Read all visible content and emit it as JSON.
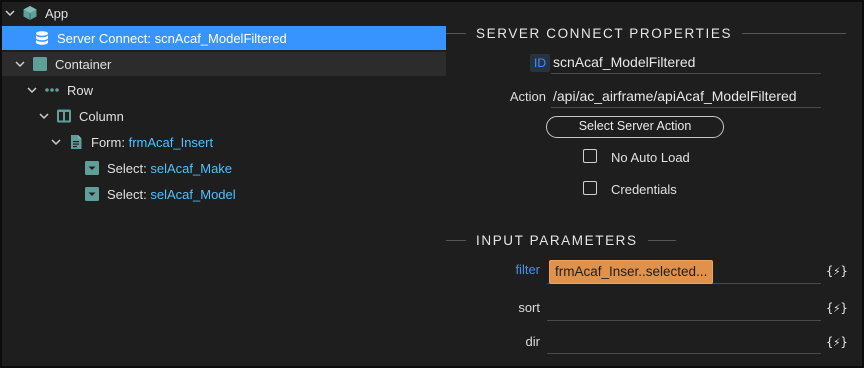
{
  "tree": {
    "app": {
      "label": "App"
    },
    "server_connect": {
      "type": "Server Connect:",
      "name": "scnAcaf_ModelFiltered"
    },
    "container": {
      "label": "Container"
    },
    "row": {
      "label": "Row"
    },
    "column": {
      "label": "Column"
    },
    "form": {
      "type": "Form:",
      "name": "frmAcaf_Insert"
    },
    "select_make": {
      "type": "Select:",
      "name": "selAcaf_Make"
    },
    "select_model": {
      "type": "Select:",
      "name": "selAcaf_Model"
    }
  },
  "properties": {
    "title": "SERVER CONNECT PROPERTIES",
    "id_label": "ID",
    "id_value": "scnAcaf_ModelFiltered",
    "action_label": "Action",
    "action_value": "/api/ac_airframe/apiAcaf_ModelFiltered",
    "select_action_button": "Select Server Action",
    "no_auto_load": "No Auto Load",
    "credentials": "Credentials"
  },
  "input_parameters": {
    "title": "INPUT PARAMETERS",
    "params": [
      {
        "name": "filter",
        "value": "frmAcaf_Inser..selected..."
      },
      {
        "name": "sort",
        "value": ""
      },
      {
        "name": "dir",
        "value": ""
      }
    ],
    "dynamic_symbol": "{⚡}"
  },
  "colors": {
    "selected": "#3794ff",
    "accent": "#4fc1ff",
    "chip": "#e0914a",
    "icon_teal": "#5f9e99"
  }
}
